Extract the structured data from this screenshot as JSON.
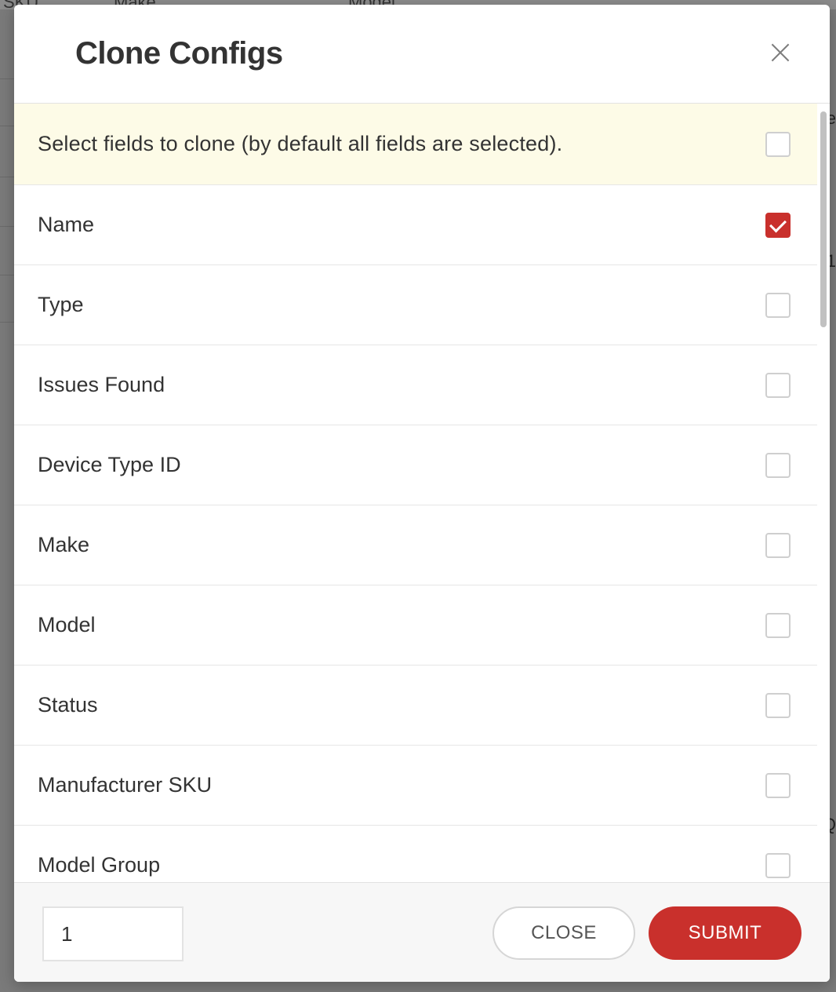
{
  "modal": {
    "title": "Clone Configs",
    "info_text": "Select fields to clone (by default all fields are selected).",
    "info_checked": false,
    "fields": [
      {
        "label": "Name",
        "checked": true
      },
      {
        "label": "Type",
        "checked": false
      },
      {
        "label": "Issues Found",
        "checked": false
      },
      {
        "label": "Device Type ID",
        "checked": false
      },
      {
        "label": "Make",
        "checked": false
      },
      {
        "label": "Model",
        "checked": false
      },
      {
        "label": "Status",
        "checked": false
      },
      {
        "label": "Manufacturer SKU",
        "checked": false
      },
      {
        "label": "Model Group",
        "checked": false
      }
    ],
    "footer": {
      "count_value": "1",
      "close_label": "CLOSE",
      "submit_label": "SUBMIT"
    }
  },
  "background": {
    "header_fragments": [
      "SKU",
      "Make",
      "Model"
    ],
    "right_edge_chars": [
      "e",
      "1",
      "Q"
    ]
  },
  "colors": {
    "accent": "#c9302c",
    "info_bg": "#fdfbe7"
  }
}
